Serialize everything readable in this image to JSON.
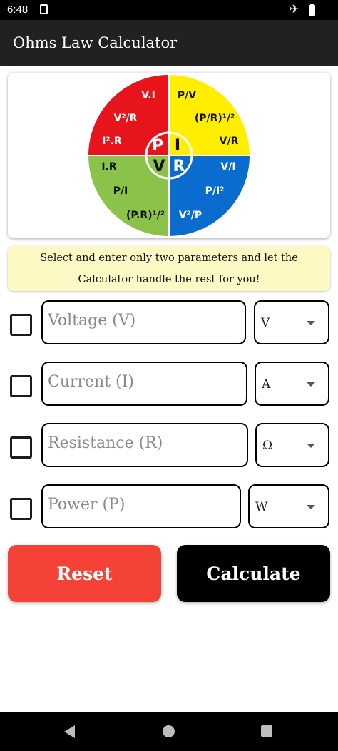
{
  "status_bar": {
    "time": "6:48",
    "icons": [
      "sim-icon",
      "airplane-icon",
      "battery-icon"
    ]
  },
  "app_bar": {
    "title": "Ohms Law Calculator"
  },
  "diagram": {
    "center_letters": {
      "p": "P",
      "i": "I",
      "v": "V",
      "r": "R"
    },
    "quadrants": {
      "power": {
        "color": "#e8141c",
        "formulas": [
          "V.I",
          "V²/R",
          "I².R"
        ]
      },
      "current": {
        "color": "#ffee00",
        "formulas": [
          "P/V",
          "(P/R)¹/²",
          "V/R"
        ]
      },
      "voltage": {
        "color": "#8bc34a",
        "formulas": [
          "I.R",
          "P/I",
          "(P.R)¹/²"
        ]
      },
      "resistance": {
        "color": "#0a6ccf",
        "formulas": [
          "V/I",
          "P/I²",
          "V²/P"
        ]
      }
    }
  },
  "hint": {
    "text": "Select and enter only two parameters and let the Calculator handle the rest for you!"
  },
  "fields": [
    {
      "placeholder": "Voltage (V)",
      "value": "",
      "unit": "V"
    },
    {
      "placeholder": "Current (I)",
      "value": "",
      "unit": "A"
    },
    {
      "placeholder": "Resistance (R)",
      "value": "",
      "unit": "Ω"
    },
    {
      "placeholder": "Power (P)",
      "value": "",
      "unit": "W"
    }
  ],
  "buttons": {
    "reset_label": "Reset",
    "calculate_label": "Calculate"
  },
  "colors": {
    "reset": "#f44336",
    "calculate": "#000000",
    "hint_background": "#fdf9c4",
    "app_bar": "#212121"
  }
}
